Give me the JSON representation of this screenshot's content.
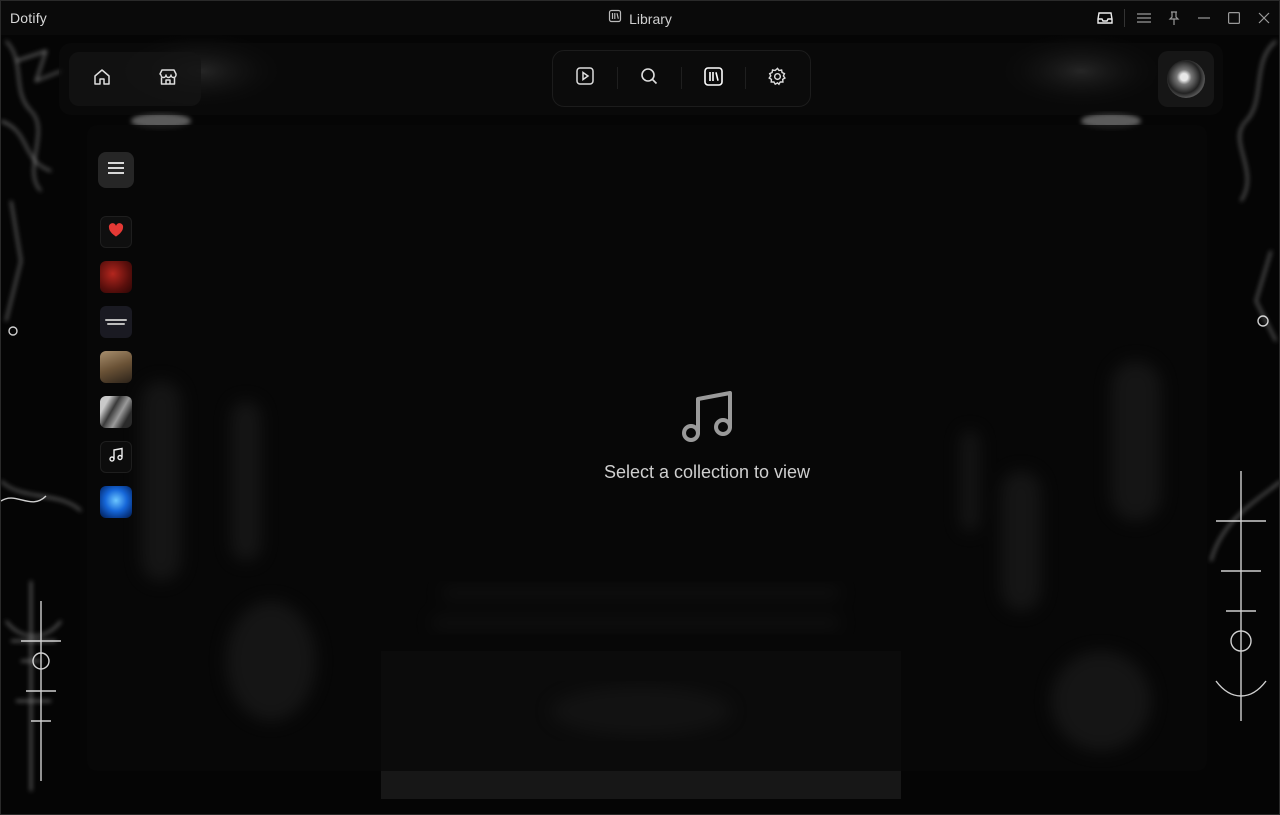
{
  "app": {
    "name": "Dotify"
  },
  "titlebar": {
    "title": "Library",
    "title_icon": "library-icon",
    "buttons": [
      "inbox-icon",
      "menu-icon",
      "pin-icon",
      "minimize-icon",
      "maximize-icon",
      "close-icon"
    ]
  },
  "nav": {
    "left": [
      "home-icon",
      "store-icon"
    ],
    "center": [
      "play-square-icon",
      "search-icon",
      "library-icon",
      "gear-icon"
    ],
    "right": "avatar"
  },
  "sidebar": {
    "menu_icon": "hamburger-icon",
    "collections": [
      {
        "kind": "liked",
        "icon": "heart-icon",
        "color": "#e53935"
      },
      {
        "kind": "cover",
        "color": "#b3261e"
      },
      {
        "kind": "cover-text"
      },
      {
        "kind": "cover",
        "color": "#8a6e4c"
      },
      {
        "kind": "cover",
        "color": "#9a9a9a"
      },
      {
        "kind": "playlist",
        "icon": "music-note-icon"
      },
      {
        "kind": "cover",
        "color": "#1667d9"
      }
    ]
  },
  "main": {
    "empty_icon": "music-note-icon",
    "empty_message": "Select a collection to view"
  }
}
